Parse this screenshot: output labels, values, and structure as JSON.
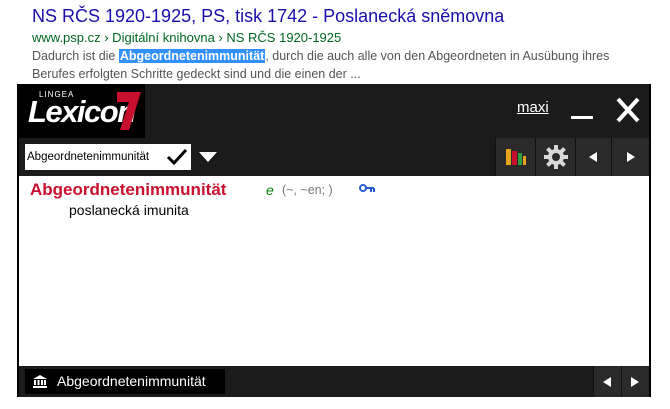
{
  "search_result": {
    "title": "NS RČS 1920-1925, PS, tisk 1742 - Poslanecká sněmovna",
    "url": "www.psp.cz › Digitální knihovna › NS RČS 1920-1925",
    "snippet_before": "Dadurch ist die ",
    "snippet_highlight": "Abgeordnetenimmunität",
    "snippet_after": ", durch die auch alle von den Abgeordneten in Ausübung ihres Berufes erfolgten Schritte gedeckt sind und die einen der ..."
  },
  "lexicon": {
    "brand_small": "LINGEA",
    "brand_word": "Lexicon",
    "brand_number": "7",
    "maxi_label": "maxi",
    "search_value": "Abgeordnetenimmunität",
    "entry": {
      "headword": "Abgeordnetenimmunität",
      "grammar": "e",
      "forms": "(~, ~en; )",
      "translation": "poslanecká imunita"
    },
    "history_label": "Abgeordnetenimmunität",
    "colors": {
      "accent_red": "#c8102e",
      "grammar_green": "#0a8a0a",
      "panel_dark": "#1b1b1b"
    }
  }
}
